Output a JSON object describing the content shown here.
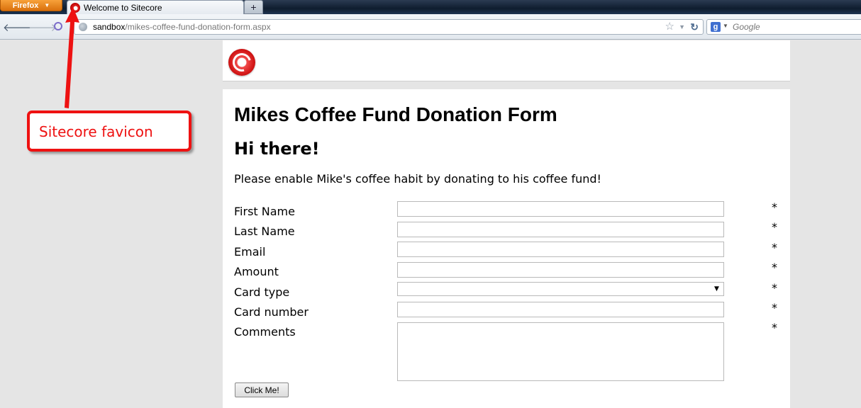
{
  "browser": {
    "menu_button": "Firefox",
    "tab_title": "Welcome to Sitecore",
    "new_tab": "+",
    "url_host": "sandbox",
    "url_path": "/mikes-coffee-fund-donation-form.aspx",
    "search_engine_letter": "g",
    "search_placeholder": "Google"
  },
  "page": {
    "form_title": "Mikes Coffee Fund Donation Form",
    "greeting": "Hi there!",
    "intro": "Please enable Mike's coffee habit by donating to his coffee fund!",
    "fields": [
      {
        "label": "First Name",
        "value": "",
        "required": "*"
      },
      {
        "label": "Last Name",
        "value": "",
        "required": "*"
      },
      {
        "label": "Email",
        "value": "",
        "required": "*"
      },
      {
        "label": "Amount",
        "value": "",
        "required": "*"
      },
      {
        "label": "Card type",
        "value": "",
        "required": "*"
      },
      {
        "label": "Card number",
        "value": "",
        "required": "*"
      },
      {
        "label": "Comments",
        "value": "",
        "required": "*"
      }
    ],
    "submit_label": "Click Me!"
  },
  "annotation": {
    "text": "Sitecore favicon",
    "color": "#ee1111"
  },
  "icons": [
    "firefox-menu-caret-icon",
    "sitecore-favicon-icon",
    "back-arrow-icon",
    "forward-arrow-icon",
    "addon-icon",
    "globe-icon",
    "bookmark-star-icon",
    "history-dropdown-icon",
    "reload-icon",
    "google-search-icon",
    "sitecore-logo-icon",
    "select-caret-icon"
  ]
}
